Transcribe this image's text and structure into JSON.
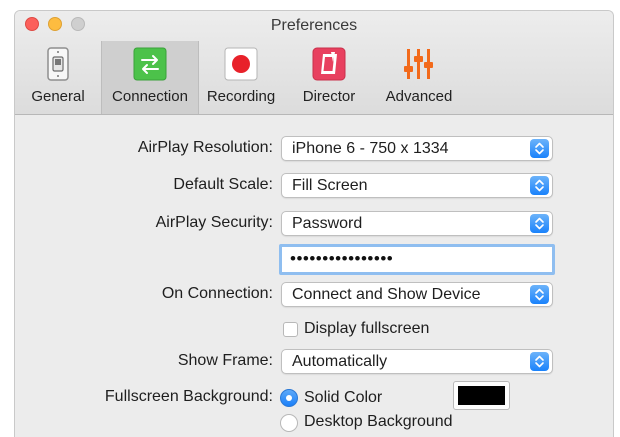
{
  "window": {
    "title": "Preferences"
  },
  "toolbar": {
    "tabs": [
      {
        "label": "General",
        "icon": "light-switch-icon"
      },
      {
        "label": "Connection",
        "icon": "arrows-exchange-icon",
        "selected": true
      },
      {
        "label": "Recording",
        "icon": "record-dot-icon"
      },
      {
        "label": "Director",
        "icon": "director-clapper-icon"
      },
      {
        "label": "Advanced",
        "icon": "sliders-icon"
      }
    ]
  },
  "settings": {
    "airplay_resolution": {
      "label": "AirPlay Resolution:",
      "value": "iPhone 6 - 750 x 1334"
    },
    "default_scale": {
      "label": "Default Scale:",
      "value": "Fill Screen"
    },
    "airplay_security": {
      "label": "AirPlay Security:",
      "value": "Password"
    },
    "password": {
      "value": "••••••••••••••••"
    },
    "on_connection": {
      "label": "On Connection:",
      "value": "Connect and Show Device"
    },
    "display_fullscreen": {
      "label": "Display fullscreen",
      "checked": false
    },
    "show_frame": {
      "label": "Show Frame:",
      "value": "Automatically"
    },
    "fullscreen_background": {
      "label": "Fullscreen Background:",
      "options": [
        {
          "label": "Solid Color",
          "selected": true
        },
        {
          "label": "Desktop Background",
          "selected": false
        }
      ],
      "color": "#000000"
    }
  },
  "colors": {
    "accent": "#1a82fb",
    "record_red": "#e8212a",
    "connection_green": "#4cc24a",
    "director_pink": "#e8405f",
    "advanced_orange": "#f26a1b"
  }
}
